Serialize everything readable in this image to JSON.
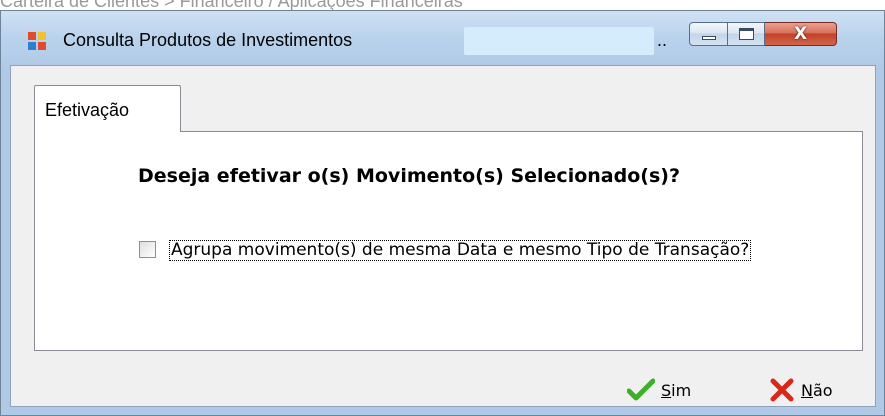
{
  "breadcrumb": "Carteira de Clientes  > Financeiro / Aplicações Financeiras",
  "window": {
    "title": "Consulta Produtos de Investimentos",
    "title_ellipsis": ".."
  },
  "tabs": [
    {
      "label": "Efetivação",
      "active": true
    }
  ],
  "content": {
    "question": "Deseja efetivar o(s) Movimento(s) Selecionado(s)?",
    "checkbox_label": "Agrupa movimento(s) de mesma Data e mesmo Tipo de Transação?",
    "checkbox_checked": false
  },
  "buttons": {
    "yes_label": "Sim",
    "no_label": "Não"
  },
  "icons": {
    "app": "app-icon",
    "yes": "checkmark-icon",
    "no": "x-icon"
  },
  "colors": {
    "check_green": "#3fae2a",
    "x_red": "#d8281c",
    "close_red": "#c2412a"
  }
}
